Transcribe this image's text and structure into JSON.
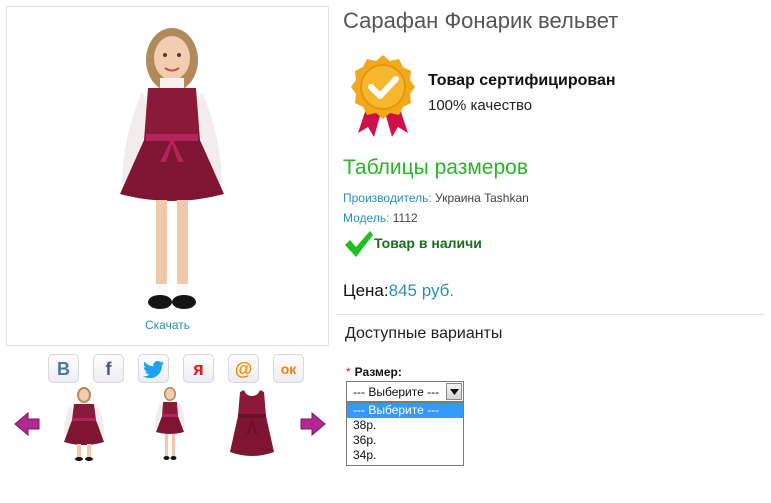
{
  "product": {
    "title": "Сарафан Фонарик вельвет",
    "download_label": "Скачать"
  },
  "social": {
    "items": [
      {
        "name": "vk",
        "glyph": "В",
        "color": "#4a76a8"
      },
      {
        "name": "facebook",
        "glyph": "f",
        "color": "#3b5998"
      },
      {
        "name": "twitter",
        "glyph": "",
        "color": "#1da1f2"
      },
      {
        "name": "yaru",
        "glyph": "я",
        "color": "#e2181a"
      },
      {
        "name": "mailru",
        "glyph": "@",
        "color": "#f08a00"
      },
      {
        "name": "odnoklassniki",
        "glyph": "ок",
        "color": "#ee8208"
      }
    ]
  },
  "certificate": {
    "title": "Товар сертифицирован",
    "subtitle": "100% качество"
  },
  "size_tables_link": "Таблицы размеров",
  "specs": {
    "manufacturer_label": "Производитель:",
    "manufacturer_value": "Украина Tashkan",
    "model_label": "Модель:",
    "model_value": "1112"
  },
  "stock_status": "Товар в наличи",
  "price": {
    "label": "Цена:",
    "value": "845 руб."
  },
  "options": {
    "title": "Доступные варианты",
    "required_mark": "*",
    "size_label": "Размер:",
    "size_selected": "--- Выберите ---",
    "size_options": [
      "--- Выберите ---",
      "38р.",
      "36р.",
      "34р."
    ]
  },
  "colors": {
    "accent_blue": "#2a8fbd",
    "accent_green": "#28b528",
    "dress_burgundy": "#8b1a3a",
    "arrow_magenta": "#b02890"
  }
}
